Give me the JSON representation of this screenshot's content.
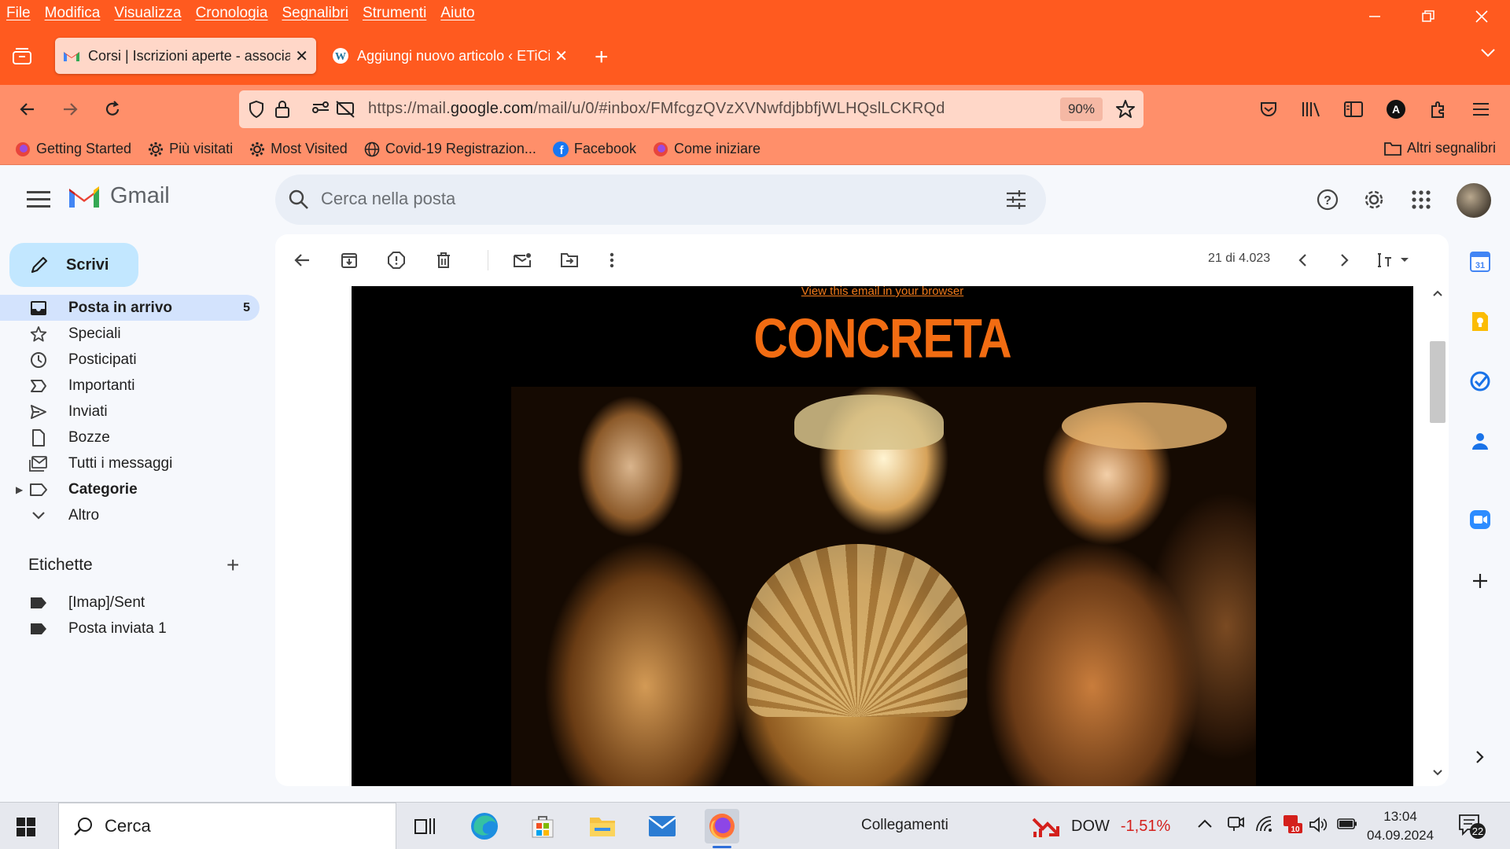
{
  "menubar": {
    "items": [
      "File",
      "Modifica",
      "Visualizza",
      "Cronologia",
      "Segnalibri",
      "Strumenti",
      "Aiuto"
    ]
  },
  "tabs": [
    {
      "label": "Corsi | Iscrizioni aperte - associa",
      "icon": "gmail-icon",
      "active": true
    },
    {
      "label": "Aggiungi nuovo articolo ‹ ETiCi",
      "icon": "wordpress-icon",
      "active": false
    }
  ],
  "urlbar": {
    "url_prefix": "https://mail.",
    "url_domain": "google.com",
    "url_path": "/mail/u/0/#inbox/FMfcgzQVzXVNwfdjbbfjWLHQslLCKRQd",
    "zoom": "90%"
  },
  "bookmarks": [
    {
      "label": "Getting Started",
      "icon": "firefox-icon"
    },
    {
      "label": "Più visitati",
      "icon": "gear-icon"
    },
    {
      "label": "Most Visited",
      "icon": "gear-icon"
    },
    {
      "label": "Covid-19 Registrazion...",
      "icon": "globe-icon"
    },
    {
      "label": "Facebook",
      "icon": "facebook-icon"
    },
    {
      "label": "Come iniziare",
      "icon": "firefox-icon"
    }
  ],
  "bookmarks_other": "Altri segnalibri",
  "gmail": {
    "brand": "Gmail",
    "search_placeholder": "Cerca nella posta",
    "compose": "Scrivi",
    "nav": [
      {
        "label": "Posta in arrivo",
        "count": "5",
        "icon": "inbox-icon",
        "active": true
      },
      {
        "label": "Speciali",
        "count": "",
        "icon": "star-icon",
        "active": false
      },
      {
        "label": "Posticipati",
        "count": "",
        "icon": "clock-icon",
        "active": false
      },
      {
        "label": "Importanti",
        "count": "",
        "icon": "important-icon",
        "active": false
      },
      {
        "label": "Inviati",
        "count": "",
        "icon": "send-icon",
        "active": false
      },
      {
        "label": "Bozze",
        "count": "",
        "icon": "draft-icon",
        "active": false
      },
      {
        "label": "Tutti i messaggi",
        "count": "",
        "icon": "all-mail-icon",
        "active": false
      },
      {
        "label": "Categorie",
        "count": "",
        "icon": "label-outline-icon",
        "active": false
      },
      {
        "label": "Altro",
        "count": "",
        "icon": "chevron-down-icon",
        "active": false
      }
    ],
    "labels_title": "Etichette",
    "labels": [
      "[Imap]/Sent",
      "Posta inviata 1"
    ],
    "pager": "21 di 4.023"
  },
  "email": {
    "view_link": "View this email in your browser",
    "brand": "CONCRETA"
  },
  "taskbar": {
    "search": "Cerca",
    "links": "Collegamenti",
    "stock_name": "DOW",
    "stock_change": "-1,51%",
    "time": "13:04",
    "date": "04.09.2024",
    "notifications": "22",
    "calendar_badge": "10"
  },
  "colors": {
    "firefox_orange": "#ff5a1f",
    "toolbar_salmon": "#ff8f6a",
    "compose_blue": "#c2e7ff",
    "active_nav": "#d3e3fd",
    "brand_orange": "#f26c12"
  }
}
